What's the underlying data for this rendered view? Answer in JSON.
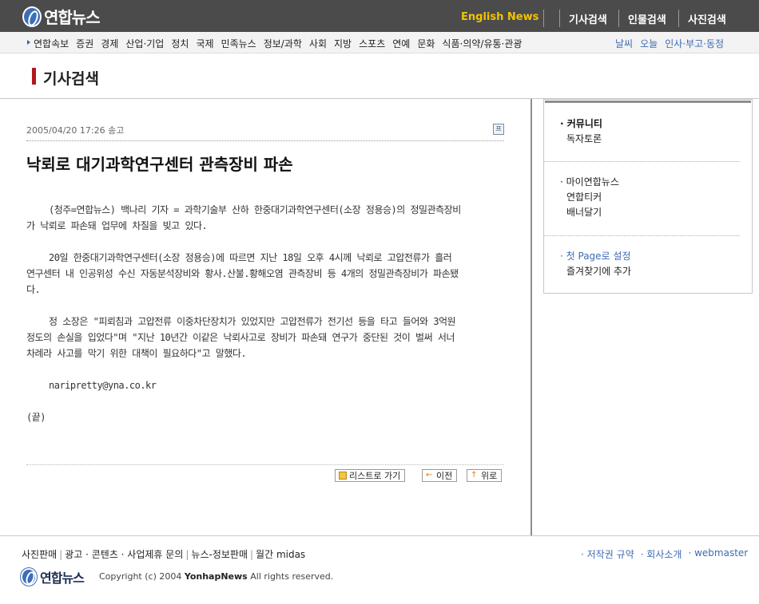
{
  "header": {
    "logo_text": "연합뉴스",
    "english_news": "English News",
    "top_links": [
      "기사검색",
      "인물검색",
      "사진검색"
    ]
  },
  "nav": {
    "categories": [
      "연합속보",
      "증권",
      "경제",
      "산업·기업",
      "정치",
      "국제",
      "민족뉴스",
      "정보/과학",
      "사회",
      "지방",
      "스포츠",
      "연예",
      "문화",
      "식품·의약/유통·관광"
    ],
    "utility": [
      "날씨",
      "오늘",
      "인사·부고·동정"
    ]
  },
  "page": {
    "title": "기사검색"
  },
  "article": {
    "meta": "2005/04/20 17:26 송고",
    "headline": "낙뢰로 대기과학연구센터 관측장비 파손",
    "paragraphs": [
      "(청주=연합뉴스) 백나리 기자 = 과학기술부 산하 한중대기과학연구센터(소장 정용승)의 정밀관측장비가 낙뢰로 파손돼 업무에 차질을 빚고 있다.",
      "20일 한중대기과학연구센터(소장 정용승)에 따르면 지난 18일 오후 4시께  낙뢰로 고압전류가 흘러 연구센터 내 인공위성 수신 자동분석장비와 황사.산불.황해오염 관측장비 등 4개의 정밀관측장비가 파손됐다.",
      "정 소장은 \"피뢰침과 고압전류 이중차단장치가 있었지만 고압전류가 전기선  등을 타고 들어와 3억원 정도의 손실을 입었다\"며 \"지난 10년간 이같은 낙뢰사고로 장비가 파손돼 연구가 중단된 것이 벌써 서너차례라 사고를 막기 위한 대책이  필요하다\"고 말했다."
    ],
    "email": "naripretty@yna.co.kr",
    "end_mark": "(끝)",
    "print_icon_label": "프"
  },
  "buttons": {
    "list": "리스트로 가기",
    "prev": "이전",
    "top": "위로"
  },
  "sidebar": {
    "community_head": "커뮤니티",
    "community_items": [
      "독자토론"
    ],
    "my_head": "마이연합뉴스",
    "my_items": [
      "연합티커",
      "배너달기"
    ],
    "homepage": "첫 Page로 설정",
    "bookmark": "즐겨찾기에 추가"
  },
  "footer": {
    "links": [
      "사진판매",
      "광고 · 콘텐츠 · 사업제휴 문의",
      "뉴스-정보판매",
      "월간 midas"
    ],
    "right_links": [
      "저작권 규약",
      "회사소개",
      "webmaster"
    ],
    "logo_text": "연합뉴스",
    "copyright_prefix": "Copyright (c) 2004",
    "copyright_brand": "YonhapNews",
    "copyright_suffix": "All rights reserved."
  },
  "colors": {
    "topbar": "#4b4b4b",
    "english_news": "#f2c300",
    "title_accent": "#b0191e",
    "link_blue": "#3c6bb5"
  }
}
